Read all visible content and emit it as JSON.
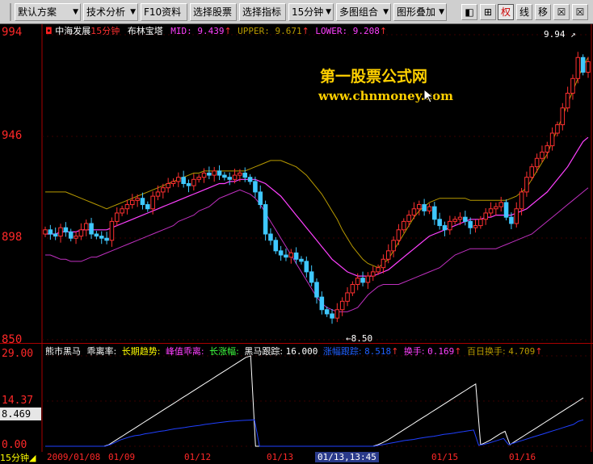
{
  "toolbar": {
    "buttons": [
      "默认方案",
      "技术分析",
      "F10资料",
      "选择股票",
      "选择指标",
      "15分钟",
      "多图组合",
      "图形叠加"
    ],
    "tools": [
      "◧",
      "⊞",
      "权",
      "线",
      "移",
      "☒",
      "☒"
    ]
  },
  "chart": {
    "stock_name": "中海发展",
    "period": "15分钟",
    "indicator": "布林宝塔",
    "mid_label": "MID:",
    "mid_value": "9.439",
    "upper_label": "UPPER:",
    "upper_value": "9.671",
    "lower_label": "LOWER:",
    "lower_value": "9.208",
    "arrow": "↑",
    "high_marker": "9.94",
    "low_marker": "8.50",
    "watermark_cn": "第一股票公式网",
    "watermark_url": "www.chnmoney.com",
    "colors": {
      "up": "#ff3030",
      "down": "#3fc8ff",
      "mid": "#b89a00",
      "upper": "#ff40ff",
      "lower": "#c030c0",
      "axis": "#ff2828"
    }
  },
  "sub": {
    "title": "熊市黑马",
    "ratio_label": "乖离率:",
    "trend_label": "长期趋势:",
    "peak_label": "峰值乖离:",
    "rise_label": "长涨幅:",
    "horse_label": "黑马跟踪:",
    "horse_value": "16.000",
    "amp_label": "涨幅跟踪:",
    "amp_value": "8.518",
    "turnover_label": "换手:",
    "turnover_value": "0.169",
    "hundred_label": "百日换手:",
    "hundred_value": "4.709",
    "current": "8.469",
    "arrow": "↑"
  },
  "x_axis": {
    "period": "15分钟",
    "labels": [
      "2009/01/08",
      "01/09",
      "01/12",
      "01/13",
      "01/13,13:45",
      "01/15",
      "01/16"
    ]
  },
  "chart_data": {
    "type": "candlestick",
    "y_ticks": [
      "994",
      "946",
      "898",
      "850"
    ],
    "sub_y_ticks": [
      "29.00",
      "14.37",
      "0.00"
    ],
    "ylim": [
      8.5,
      9.94
    ],
    "sub_ylim": [
      0,
      29
    ],
    "closes": [
      9.0,
      8.98,
      8.97,
      9.01,
      8.99,
      8.96,
      8.97,
      9.0,
      9.03,
      8.98,
      8.97,
      8.96,
      8.95,
      9.04,
      9.08,
      9.1,
      9.12,
      9.14,
      9.15,
      9.12,
      9.1,
      9.16,
      9.18,
      9.2,
      9.22,
      9.23,
      9.25,
      9.22,
      9.21,
      9.24,
      9.25,
      9.27,
      9.26,
      9.28,
      9.26,
      9.25,
      9.24,
      9.26,
      9.27,
      9.25,
      9.23,
      9.18,
      9.12,
      8.98,
      8.95,
      8.9,
      8.88,
      8.87,
      8.89,
      8.86,
      8.85,
      8.8,
      8.75,
      8.68,
      8.62,
      8.6,
      8.58,
      8.62,
      8.66,
      8.7,
      8.74,
      8.77,
      8.75,
      8.78,
      8.8,
      8.82,
      8.86,
      8.9,
      8.95,
      9.0,
      9.04,
      9.07,
      9.1,
      9.12,
      9.09,
      9.11,
      9.05,
      9.02,
      9.0,
      9.04,
      9.05,
      9.06,
      9.04,
      9.01,
      9.02,
      9.05,
      9.08,
      9.1,
      9.11,
      9.13,
      9.06,
      9.03,
      9.1,
      9.18,
      9.25,
      9.3,
      9.34,
      9.37,
      9.4,
      9.46,
      9.5,
      9.58,
      9.65,
      9.72,
      9.82,
      9.75,
      9.8
    ],
    "mid": [
      8.98,
      8.98,
      8.98,
      8.99,
      8.99,
      8.99,
      8.99,
      9.0,
      9.0,
      9.0,
      9.0,
      9.0,
      9.0,
      9.01,
      9.02,
      9.03,
      9.04,
      9.05,
      9.06,
      9.07,
      9.08,
      9.09,
      9.1,
      9.11,
      9.12,
      9.13,
      9.14,
      9.15,
      9.16,
      9.17,
      9.18,
      9.19,
      9.2,
      9.21,
      9.22,
      9.22,
      9.23,
      9.23,
      9.24,
      9.24,
      9.24,
      9.24,
      9.23,
      9.22,
      9.2,
      9.18,
      9.16,
      9.13,
      9.1,
      9.07,
      9.04,
      9.01,
      8.98,
      8.95,
      8.92,
      8.89,
      8.86,
      8.84,
      8.82,
      8.8,
      8.79,
      8.78,
      8.78,
      8.78,
      8.78,
      8.79,
      8.8,
      8.81,
      8.83,
      8.85,
      8.87,
      8.89,
      8.91,
      8.93,
      8.95,
      8.97,
      8.98,
      8.99,
      9.0,
      9.01,
      9.02,
      9.03,
      9.04,
      9.05,
      9.05,
      9.05,
      9.06,
      9.06,
      9.07,
      9.07,
      9.07,
      9.07,
      9.08,
      9.09,
      9.1,
      9.12,
      9.14,
      9.16,
      9.18,
      9.21,
      9.24,
      9.27,
      9.3,
      9.34,
      9.38,
      9.42,
      9.44
    ],
    "upper": [
      9.18,
      9.18,
      9.18,
      9.18,
      9.18,
      9.17,
      9.16,
      9.15,
      9.14,
      9.13,
      9.12,
      9.11,
      9.1,
      9.11,
      9.12,
      9.13,
      9.14,
      9.15,
      9.16,
      9.17,
      9.18,
      9.19,
      9.2,
      9.21,
      9.22,
      9.23,
      9.24,
      9.25,
      9.26,
      9.27,
      9.27,
      9.28,
      9.28,
      9.28,
      9.28,
      9.28,
      9.28,
      9.28,
      9.28,
      9.28,
      9.29,
      9.3,
      9.31,
      9.32,
      9.33,
      9.33,
      9.33,
      9.32,
      9.31,
      9.3,
      9.28,
      9.26,
      9.23,
      9.2,
      9.17,
      9.13,
      9.09,
      9.05,
      9.0,
      8.96,
      8.92,
      8.89,
      8.86,
      8.84,
      8.83,
      8.82,
      8.84,
      8.86,
      8.9,
      8.94,
      8.98,
      9.02,
      9.06,
      9.09,
      9.11,
      9.13,
      9.14,
      9.15,
      9.15,
      9.15,
      9.15,
      9.15,
      9.15,
      9.14,
      9.14,
      9.14,
      9.14,
      9.14,
      9.14,
      9.14,
      9.14,
      9.15,
      9.16,
      9.18,
      9.2,
      9.24,
      9.28,
      9.32,
      9.36,
      9.42,
      9.48,
      9.54,
      9.6,
      9.66,
      9.72,
      9.78,
      9.82
    ],
    "lower": [
      8.88,
      8.88,
      8.87,
      8.86,
      8.86,
      8.85,
      8.85,
      8.85,
      8.86,
      8.87,
      8.87,
      8.88,
      8.89,
      8.9,
      8.91,
      8.92,
      8.93,
      8.94,
      8.95,
      8.96,
      8.97,
      8.98,
      8.99,
      9.0,
      9.01,
      9.02,
      9.04,
      9.05,
      9.06,
      9.07,
      9.09,
      9.1,
      9.11,
      9.13,
      9.15,
      9.16,
      9.17,
      9.18,
      9.19,
      9.18,
      9.17,
      9.15,
      9.12,
      9.08,
      9.04,
      9.0,
      8.96,
      8.92,
      8.88,
      8.84,
      8.8,
      8.76,
      8.72,
      8.68,
      8.65,
      8.63,
      8.62,
      8.61,
      8.61,
      8.61,
      8.62,
      8.63,
      8.66,
      8.69,
      8.71,
      8.73,
      8.74,
      8.74,
      8.74,
      8.74,
      8.75,
      8.76,
      8.77,
      8.78,
      8.79,
      8.8,
      8.81,
      8.82,
      8.84,
      8.86,
      8.88,
      8.89,
      8.9,
      8.91,
      8.91,
      8.91,
      8.91,
      8.91,
      8.91,
      8.92,
      8.93,
      8.94,
      8.95,
      8.96,
      8.97,
      8.98,
      9.0,
      9.02,
      9.04,
      9.06,
      9.08,
      9.1,
      9.12,
      9.14,
      9.16,
      9.18,
      9.2
    ],
    "sub_white": [
      0,
      0,
      0,
      0,
      0,
      0,
      0,
      0,
      0,
      0,
      0,
      0,
      0,
      0.5,
      1.5,
      2.5,
      3.5,
      4.5,
      5.5,
      6.5,
      7.5,
      8.5,
      9.5,
      10.5,
      11.5,
      12.5,
      13.5,
      14.5,
      15.5,
      16.5,
      17.5,
      18.5,
      19.5,
      20.5,
      21.5,
      22.5,
      23.5,
      24.5,
      25.5,
      26.5,
      27.5,
      28.5,
      29.0,
      0,
      0,
      0,
      0,
      0,
      0,
      0,
      0,
      0,
      0,
      0,
      0,
      0,
      0,
      0,
      0,
      0,
      0,
      0,
      0,
      0,
      0,
      0,
      0,
      0,
      0.5,
      1.2,
      2.0,
      3.0,
      4.0,
      5.0,
      6.0,
      7.0,
      8.0,
      9.0,
      10.0,
      11.0,
      12.0,
      13.0,
      14.0,
      15.0,
      16.0,
      17.0,
      18.0,
      19.0,
      20.0,
      0.5,
      1.2,
      2.0,
      3.0,
      4.0,
      4.8,
      0.5,
      1.5,
      2.5,
      3.5,
      4.5,
      5.5,
      6.5,
      7.5,
      8.5,
      9.5,
      10.5,
      11.5,
      12.5,
      13.5,
      14.5,
      15.5
    ],
    "sub_blue": [
      0,
      0,
      0,
      0,
      0,
      0,
      0,
      0,
      0,
      0,
      0,
      0,
      0,
      0.5,
      1.2,
      2.0,
      2.5,
      3.0,
      3.4,
      3.6,
      4.0,
      4.2,
      4.5,
      4.8,
      5.0,
      5.3,
      5.6,
      5.8,
      6.0,
      6.3,
      6.5,
      6.7,
      7.0,
      7.2,
      7.4,
      7.6,
      7.8,
      8.0,
      8.1,
      8.2,
      8.3,
      8.4,
      8.5,
      0,
      0,
      0,
      0,
      0,
      0,
      0,
      0,
      0,
      0,
      0,
      0,
      0,
      0,
      0,
      0,
      0,
      0,
      0,
      0,
      0,
      0,
      0,
      0,
      0.3,
      0.6,
      0.9,
      1.2,
      1.5,
      1.8,
      2.0,
      2.2,
      2.5,
      2.8,
      3.0,
      3.2,
      3.5,
      3.8,
      4.0,
      4.2,
      4.5,
      4.7,
      5.0,
      5.2,
      0.3,
      0.6,
      1.0,
      1.5,
      2.0,
      2.5,
      0.5,
      1.0,
      1.5,
      2.0,
      2.5,
      3.0,
      3.5,
      4.0,
      4.5,
      5.0,
      5.5,
      6.0,
      6.5,
      7.0,
      8.0,
      8.47
    ]
  }
}
